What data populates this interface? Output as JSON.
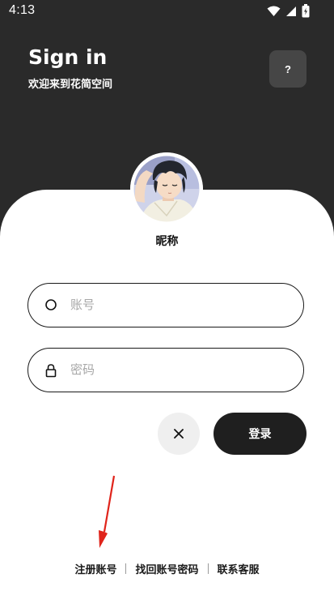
{
  "status_bar": {
    "time": "4:13",
    "icons": [
      "wifi-icon",
      "signal-icon",
      "battery-icon"
    ]
  },
  "header": {
    "title": "Sign in",
    "subtitle": "欢迎来到花简空间",
    "help_label": "?"
  },
  "profile": {
    "nickname": "昵称"
  },
  "form": {
    "account_placeholder": "账号",
    "password_placeholder": "密码",
    "account_value": "",
    "password_value": "",
    "login_label": "登录",
    "clear_icon": "close-icon"
  },
  "footer": {
    "register": "注册账号",
    "recover": "找回账号密码",
    "support": "联系客服"
  },
  "colors": {
    "header_bg": "#2a2a2a",
    "card_bg": "#ffffff",
    "primary_button": "#1f1f1f",
    "annotation_arrow": "#e0241b"
  }
}
